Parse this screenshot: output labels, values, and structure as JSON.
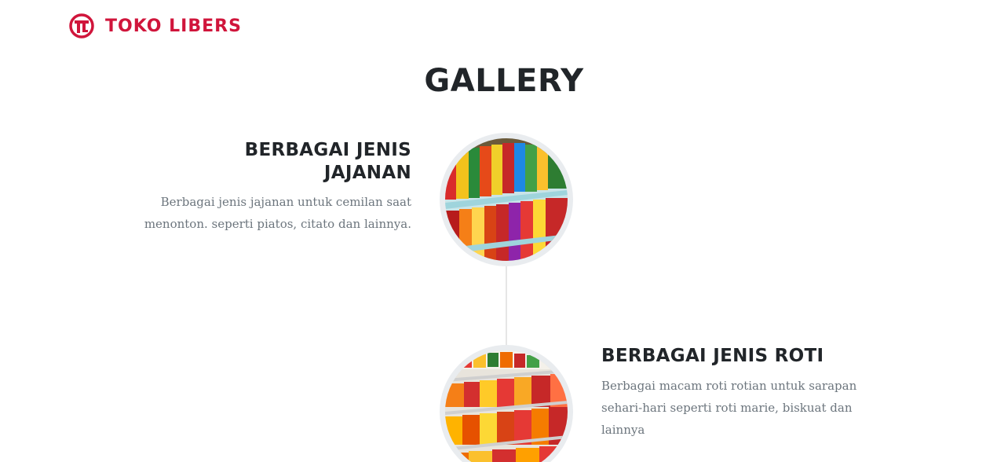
{
  "brand": {
    "name": "TOKO LIBERS",
    "accent_color": "#d0153b",
    "logo_icon": "toko-libers-logo-icon"
  },
  "gallery": {
    "title": "GALLERY",
    "items": [
      {
        "heading": "BERBAGAI JENIS JAJANAN",
        "text": "Berbagai jenis jajanan untuk cemilan saat menonton. seperti piatos, citato dan lainnya.",
        "image": "snack-shelf-photo"
      },
      {
        "heading": "BERBAGAI JENIS ROTI",
        "text": "Berbagai macam roti rotian untuk sarapan sehari-hari seperti roti marie, biskuat dan lainnya",
        "image": "bread-shelf-photo"
      }
    ]
  }
}
